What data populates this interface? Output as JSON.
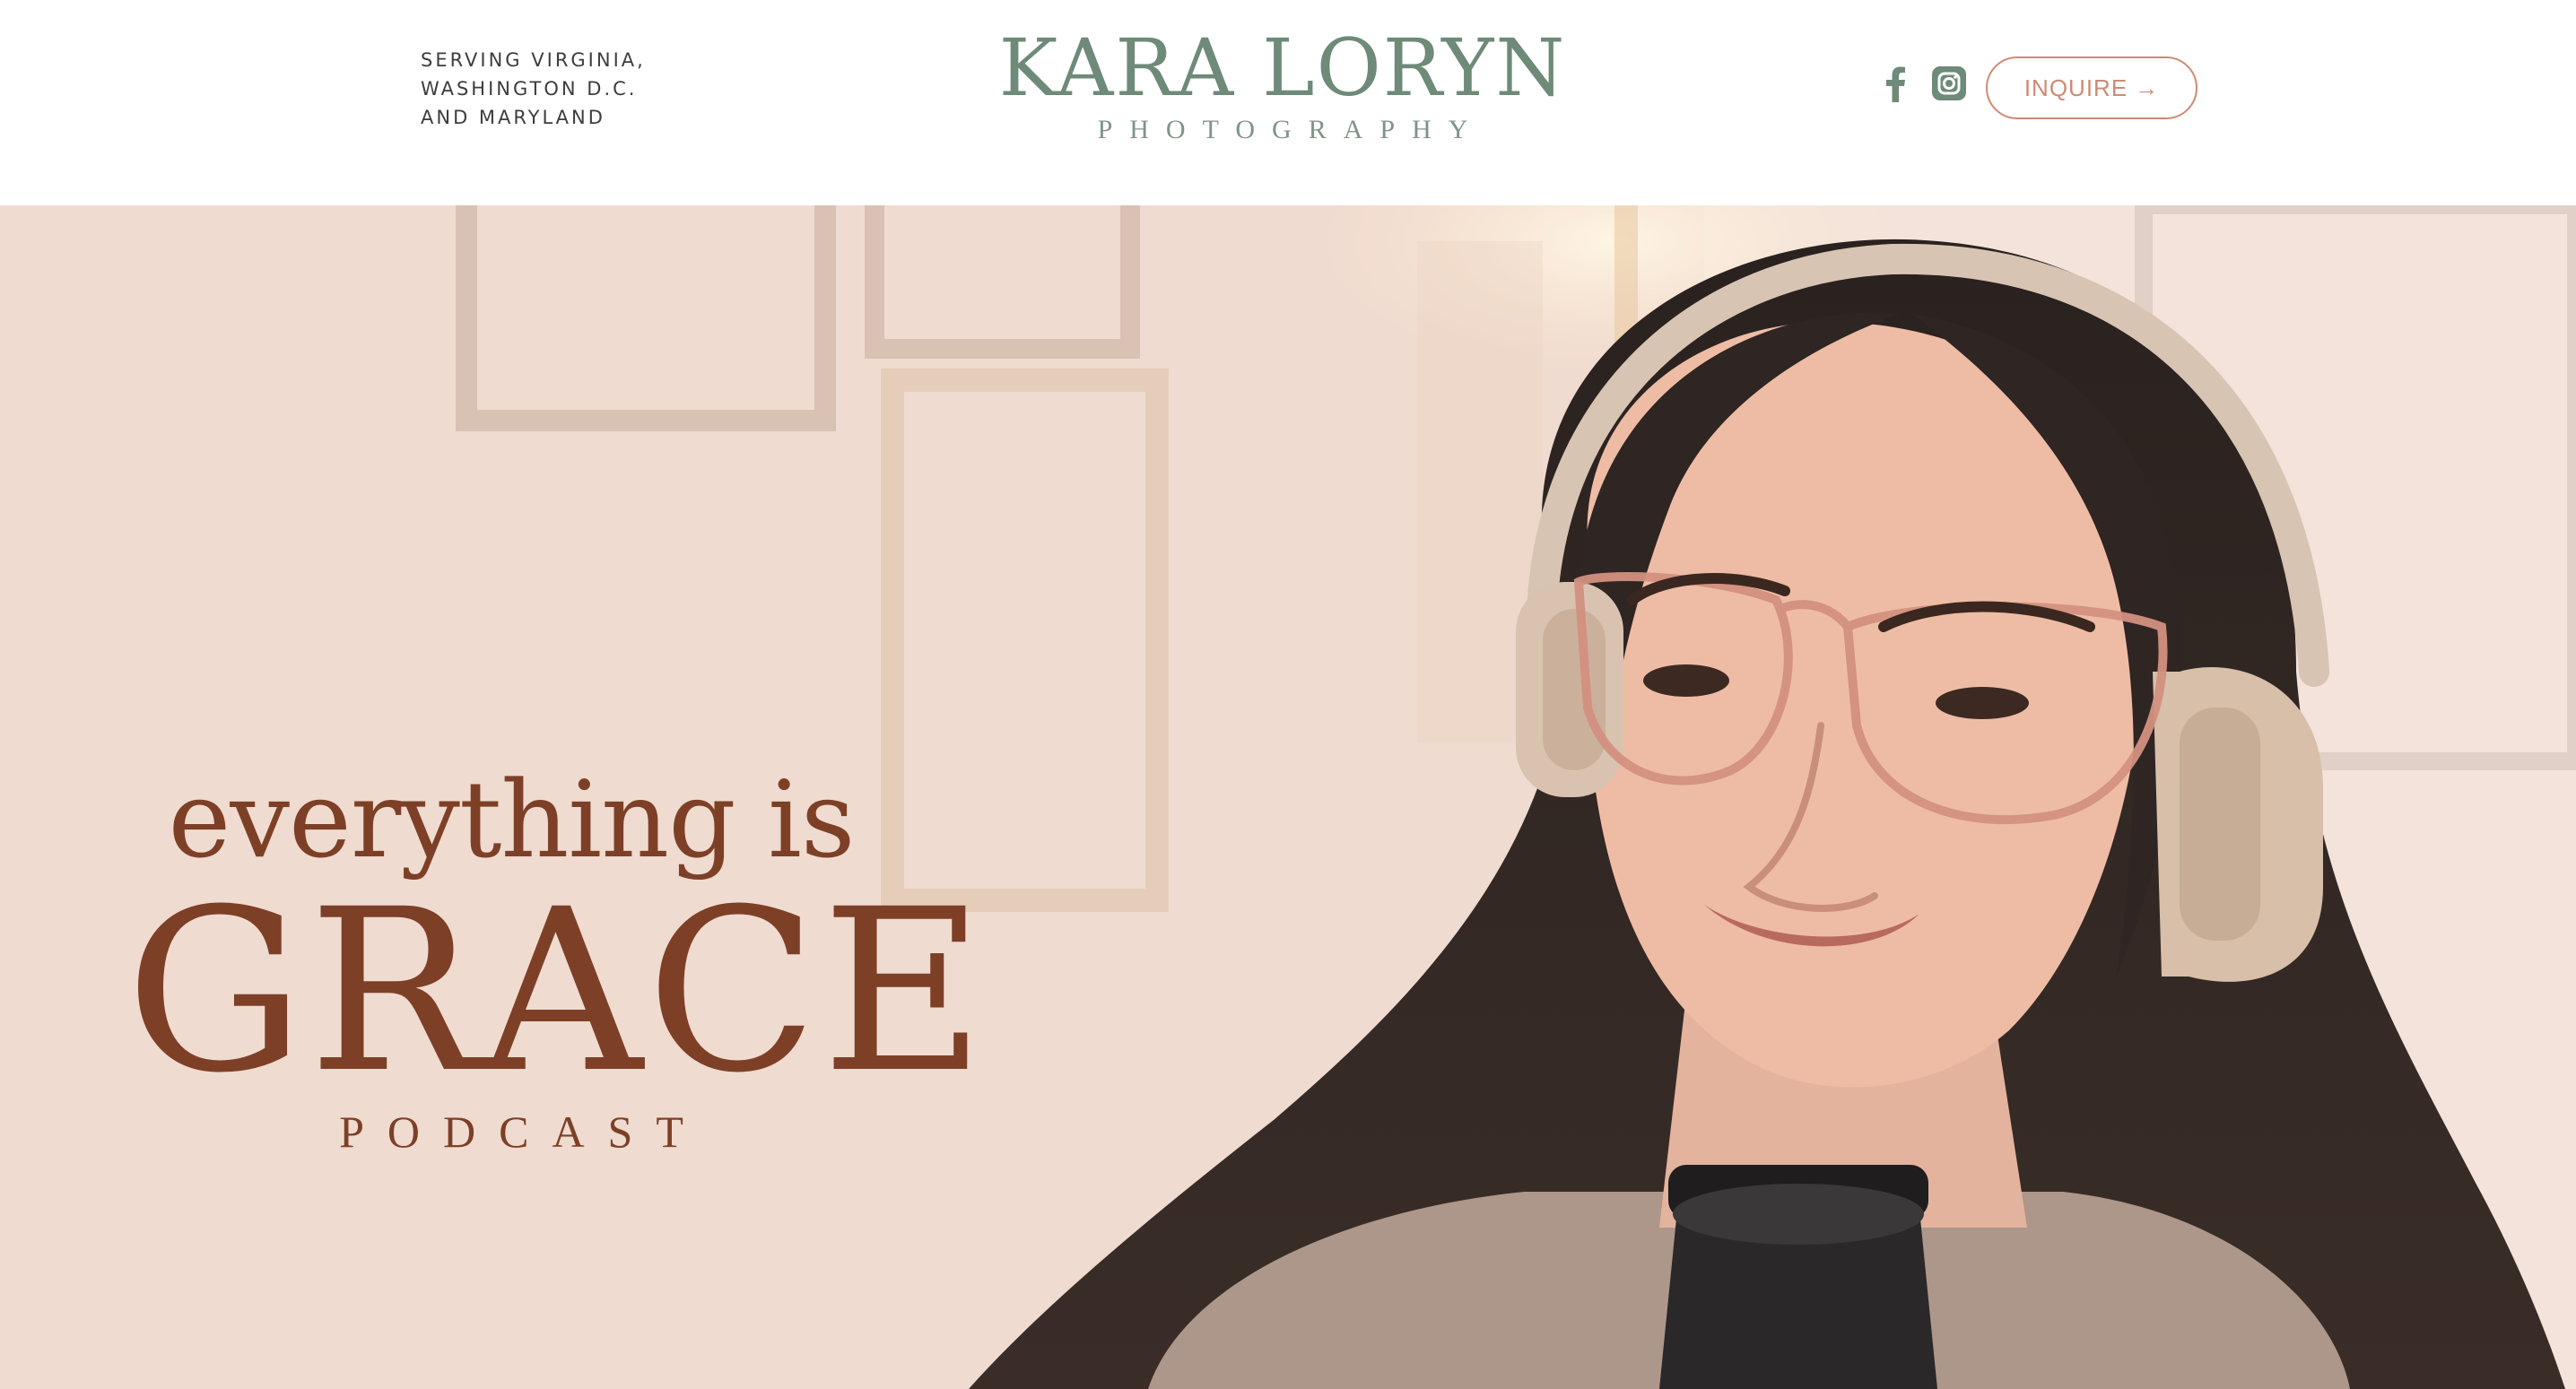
{
  "header": {
    "service_lines": [
      "SERVING VIRGINIA,",
      "WASHINGTON D.C.",
      "AND MARYLAND"
    ],
    "logo_name": "KARA LORYN",
    "logo_subtitle": "PHOTOGRAPHY",
    "social_icons": [
      "facebook-icon",
      "instagram-icon"
    ],
    "inquire_label": "INQUIRE",
    "inquire_arrow": "→"
  },
  "hero": {
    "title_top": "everything is",
    "title_main": "GRACE",
    "title_sub": "PODCAST"
  },
  "colors": {
    "logo_green": "#6e8a78",
    "accent_terracotta": "#cf8a74",
    "title_brown": "#7d4027",
    "hero_background": "#f2ddd1"
  }
}
